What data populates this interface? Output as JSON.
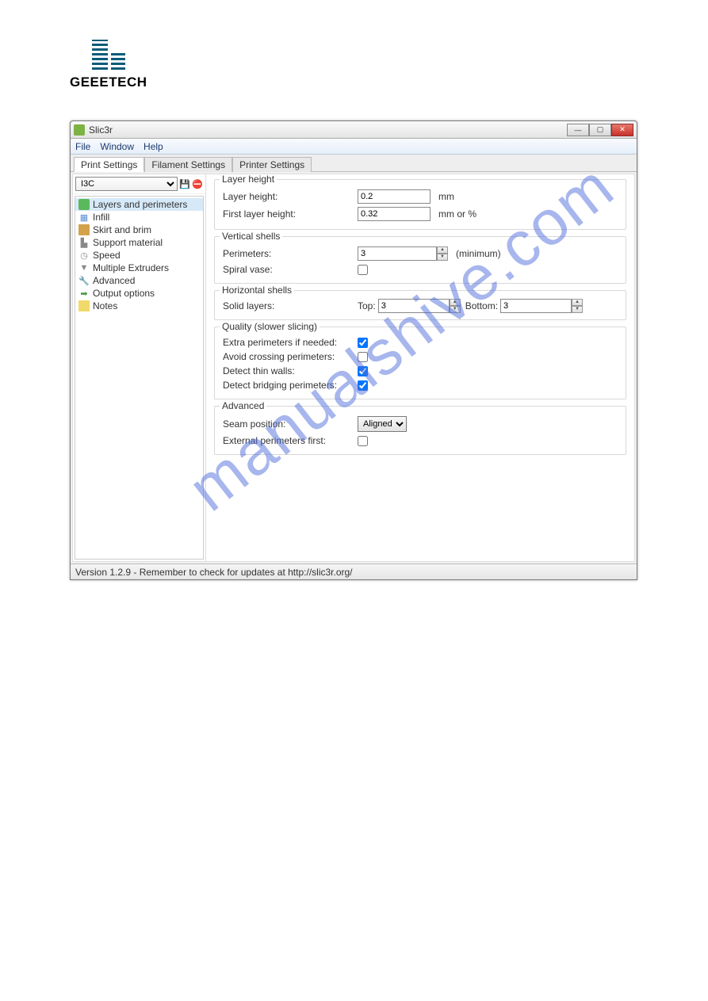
{
  "brand": "GEEETECH",
  "window": {
    "title": "Slic3r",
    "menu": {
      "file": "File",
      "window": "Window",
      "help": "Help"
    },
    "tabs": {
      "print": "Print Settings",
      "filament": "Filament Settings",
      "printer": "Printer Settings"
    },
    "preset": "I3C",
    "statusbar": "Version 1.2.9 - Remember to check for updates at http://slic3r.org/"
  },
  "sidebar": {
    "items": [
      {
        "label": "Layers and perimeters"
      },
      {
        "label": "Infill"
      },
      {
        "label": "Skirt and brim"
      },
      {
        "label": "Support material"
      },
      {
        "label": "Speed"
      },
      {
        "label": "Multiple Extruders"
      },
      {
        "label": "Advanced"
      },
      {
        "label": "Output options"
      },
      {
        "label": "Notes"
      }
    ]
  },
  "groups": {
    "layer_height": {
      "title": "Layer height",
      "layer_height_label": "Layer height:",
      "layer_height_value": "0.2",
      "layer_height_unit": "mm",
      "first_layer_label": "First layer height:",
      "first_layer_value": "0.32",
      "first_layer_unit": "mm or %"
    },
    "vertical_shells": {
      "title": "Vertical shells",
      "perimeters_label": "Perimeters:",
      "perimeters_value": "3",
      "perimeters_unit": "(minimum)",
      "spiral_label": "Spiral vase:"
    },
    "horizontal_shells": {
      "title": "Horizontal shells",
      "solid_label": "Solid layers:",
      "top_label": "Top:",
      "top_value": "3",
      "bottom_label": "Bottom:",
      "bottom_value": "3"
    },
    "quality": {
      "title": "Quality (slower slicing)",
      "extra_label": "Extra perimeters if needed:",
      "avoid_label": "Avoid crossing perimeters:",
      "thin_label": "Detect thin walls:",
      "bridging_label": "Detect bridging perimeters:"
    },
    "advanced": {
      "title": "Advanced",
      "seam_label": "Seam position:",
      "seam_value": "Aligned",
      "ext_first_label": "External perimeters first:"
    }
  },
  "watermark": "manualshive.com"
}
